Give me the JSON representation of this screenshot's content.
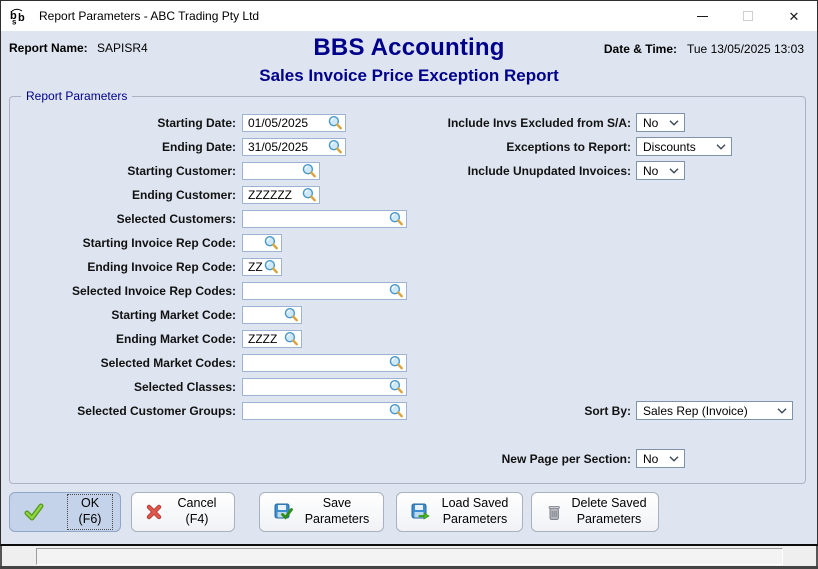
{
  "window": {
    "title": "Report Parameters - ABC Trading Pty Ltd",
    "icon": "bbs-logo-icon",
    "controls": {
      "minimize": "minimize-icon",
      "maximize": "maximize-icon-disabled",
      "close": "close-icon"
    }
  },
  "header": {
    "report_name_label": "Report Name:",
    "report_name": "SAPISR4",
    "app_title": "BBS Accounting",
    "report_title": "Sales Invoice Price Exception Report",
    "datetime_label": "Date & Time:",
    "datetime": "Tue 13/05/2025 13:03"
  },
  "group": {
    "title": "Report Parameters"
  },
  "fields_left": [
    {
      "label": "Starting Date:",
      "value": "01/05/2025",
      "icon": "magnifier-icon"
    },
    {
      "label": "Ending Date:",
      "value": "31/05/2025",
      "icon": "magnifier-icon"
    },
    {
      "label": "Starting Customer:",
      "value": "",
      "icon": "magnifier-icon"
    },
    {
      "label": "Ending Customer:",
      "value": "ZZZZZZ",
      "icon": "magnifier-icon"
    },
    {
      "label": "Selected Customers:",
      "value": "",
      "icon": "magnifier-icon"
    },
    {
      "label": "Starting Invoice Rep Code:",
      "value": "",
      "icon": "magnifier-icon"
    },
    {
      "label": "Ending Invoice Rep Code:",
      "value": "ZZ",
      "icon": "magnifier-icon"
    },
    {
      "label": "Selected Invoice Rep Codes:",
      "value": "",
      "icon": "magnifier-icon"
    },
    {
      "label": "Starting Market Code:",
      "value": "",
      "icon": "magnifier-icon"
    },
    {
      "label": "Ending Market Code:",
      "value": "ZZZZ",
      "icon": "magnifier-icon"
    },
    {
      "label": "Selected Market Codes:",
      "value": "",
      "icon": "magnifier-icon"
    },
    {
      "label": "Selected Classes:",
      "value": "",
      "icon": "magnifier-icon"
    },
    {
      "label": "Selected Customer Groups:",
      "value": "",
      "icon": "magnifier-icon"
    }
  ],
  "fields_right": [
    {
      "label": "Include Invs Excluded from S/A:",
      "value": "No"
    },
    {
      "label": "Exceptions to Report:",
      "value": "Discounts"
    },
    {
      "label": "Include Unupdated Invoices:",
      "value": "No"
    }
  ],
  "sort_by": {
    "label": "Sort By:",
    "value": "Sales Rep (Invoice)"
  },
  "new_page": {
    "label": "New Page per Section:",
    "value": "No"
  },
  "buttons": [
    {
      "label": "OK (F6)",
      "icon": "check-icon"
    },
    {
      "label": "Cancel (F4)",
      "icon": "cross-icon"
    },
    {
      "label": "Save Parameters",
      "icon": "save-disk-icon"
    },
    {
      "label": "Load Saved Parameters",
      "icon": "load-disk-icon"
    },
    {
      "label": "Delete Saved Parameters",
      "icon": "trash-icon"
    }
  ],
  "colors": {
    "navy": "#00008b",
    "dialog_bg": "#dee5f0",
    "ok_button_bg": "#c4d3e9",
    "field_border": "#9db3d2"
  }
}
